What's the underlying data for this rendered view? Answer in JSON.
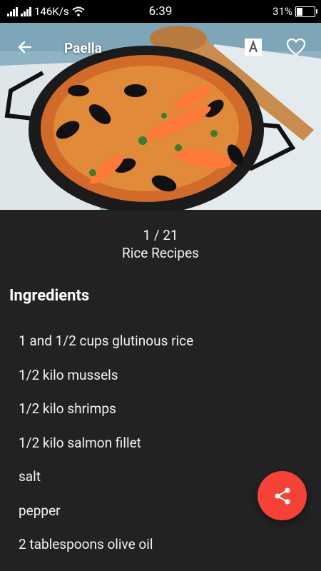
{
  "status_bar": {
    "network_speed": "146K/s",
    "time": "6:39",
    "battery_percent": "31%",
    "battery_level": 0.31
  },
  "header": {
    "title": "Paella",
    "icons": [
      "back-arrow-icon",
      "translate-icon",
      "heart-icon"
    ]
  },
  "recipe": {
    "position": "1 / 21",
    "category": "Rice Recipes"
  },
  "ingredients": {
    "title": "Ingredients",
    "items": [
      "1 and 1/2 cups glutinous rice",
      "1/2 kilo mussels",
      "1/2 kilo shrimps",
      "1/2 kilo salmon fillet",
      "salt",
      "pepper",
      "2 tablespoons olive oil"
    ]
  },
  "fab": {
    "icon": "share-icon",
    "color": "#f44336"
  }
}
